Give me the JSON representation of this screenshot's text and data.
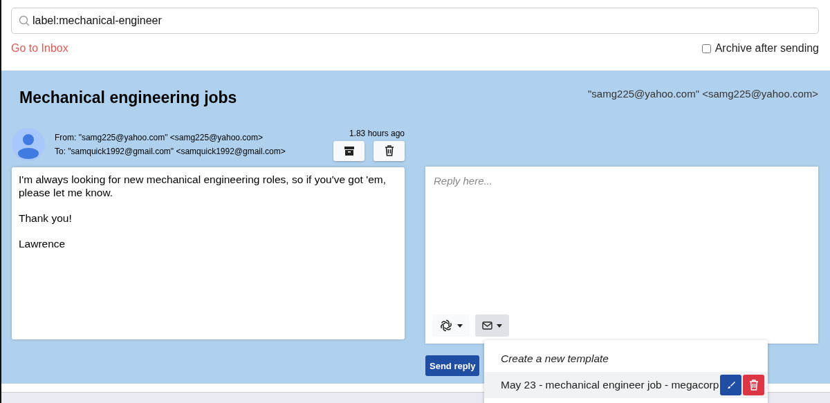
{
  "search": {
    "value": "label:mechanical-engineer"
  },
  "inbox_link": "Go to Inbox",
  "archive_after_sending": {
    "label": "Archive after sending",
    "checked": false
  },
  "email": {
    "subject": "Mechanical engineering jobs",
    "sender_header": "\"samg225@yahoo.com\" <samg225@yahoo.com>",
    "from": "From: \"samg225@yahoo.com\" <samg225@yahoo.com>",
    "to": "To: \"samquick1992@gmail.com\" <samquick1992@gmail.com>",
    "time": "1.83 hours ago",
    "body": [
      "I'm always looking for new mechanical engineering roles, so if you've got 'em, please let me know.",
      "Thank you!",
      "Lawrence"
    ]
  },
  "reply": {
    "placeholder": "Reply here...",
    "send_button": "Send reply"
  },
  "template_menu": {
    "expanded": true,
    "items": [
      {
        "kind": "create",
        "label": "Create a new template",
        "selected": false
      },
      {
        "kind": "template",
        "label": "May 23 - mechanical engineer job - megacorp",
        "selected": true
      }
    ]
  }
}
